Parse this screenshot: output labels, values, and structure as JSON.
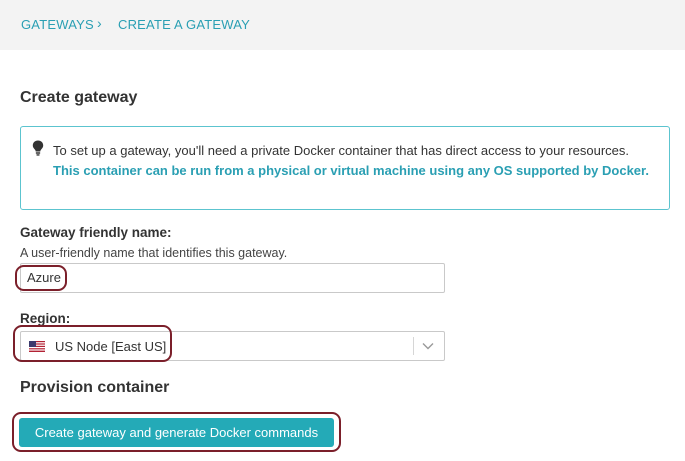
{
  "breadcrumb": {
    "items": [
      "GATEWAYS",
      "CREATE A GATEWAY"
    ],
    "separator": "›"
  },
  "page": {
    "title": "Create gateway"
  },
  "info": {
    "icon": "lightbulb-icon",
    "text_plain": "To set up a gateway, you'll need a private Docker container that has direct access to your resources. ",
    "text_accent": "This container can be run from a physical or virtual machine using any OS supported by Docker."
  },
  "form": {
    "name_label": "Gateway friendly name:",
    "name_help": "A user-friendly name that identifies this gateway.",
    "name_value": "Azure",
    "region_label": "Region:",
    "region_value": "US Node [East US]",
    "region_flag_icon": "us-flag-icon",
    "region_chevron_icon": "chevron-down-icon"
  },
  "provision": {
    "title": "Provision container",
    "button_label": "Create gateway and generate Docker commands"
  },
  "colors": {
    "accent": "#24aab7",
    "link": "#2a9fb3",
    "highlight_outline": "#7b1f2a",
    "topbar_bg": "#f3f3f3"
  }
}
